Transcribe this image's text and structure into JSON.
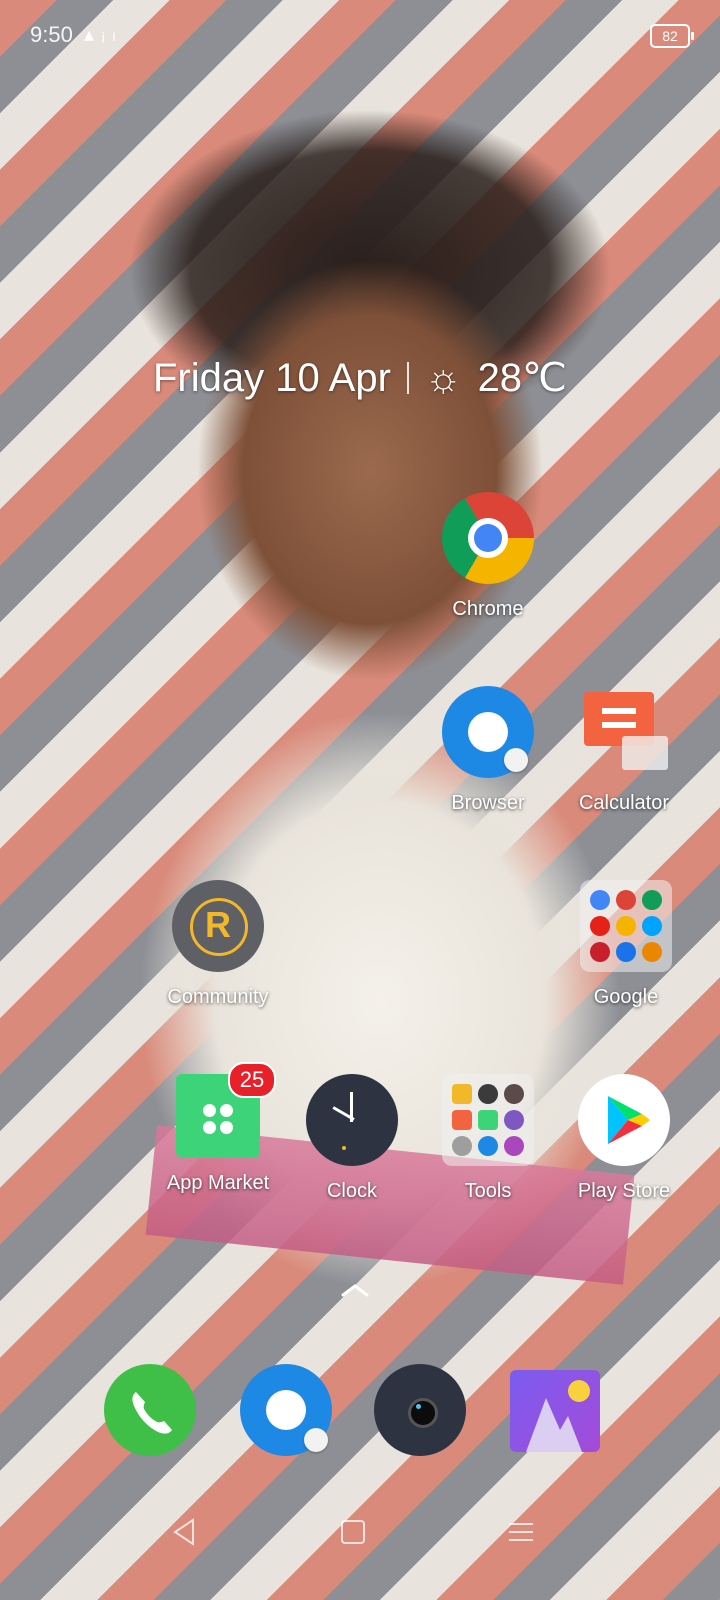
{
  "status_bar": {
    "time": "9:50",
    "signal_glyph": "▴ ᵢ ₗ",
    "battery": "82"
  },
  "widget": {
    "date": "Friday 10 Apr",
    "weather_icon": "sun-icon",
    "temperature": "28℃"
  },
  "apps": {
    "chrome": "Chrome",
    "browser": "Browser",
    "calculator": "Calculator",
    "community": "Community",
    "google": "Google",
    "app_market": "App Market",
    "app_market_badge": "25",
    "clock": "Clock",
    "tools": "Tools",
    "play_store": "Play Store"
  },
  "dock": [
    "phone-icon",
    "browser-icon",
    "camera-icon",
    "photos-icon"
  ],
  "nav": [
    "back-icon",
    "home-icon",
    "recents-icon"
  ],
  "colors": {
    "chrome_red": "#db4437",
    "chrome_yellow": "#f4b400",
    "chrome_green": "#0f9d58",
    "chrome_blue": "#4285f4",
    "browser_blue": "#1e88e5",
    "calculator_orange": "#f3633f",
    "community_gray": "#5f5f66",
    "community_yellow": "#f3b829",
    "app_market_green": "#3dd378",
    "clock_dark": "#2d3340",
    "phone_green": "#3fbf48",
    "badge_red": "#e8202a"
  }
}
